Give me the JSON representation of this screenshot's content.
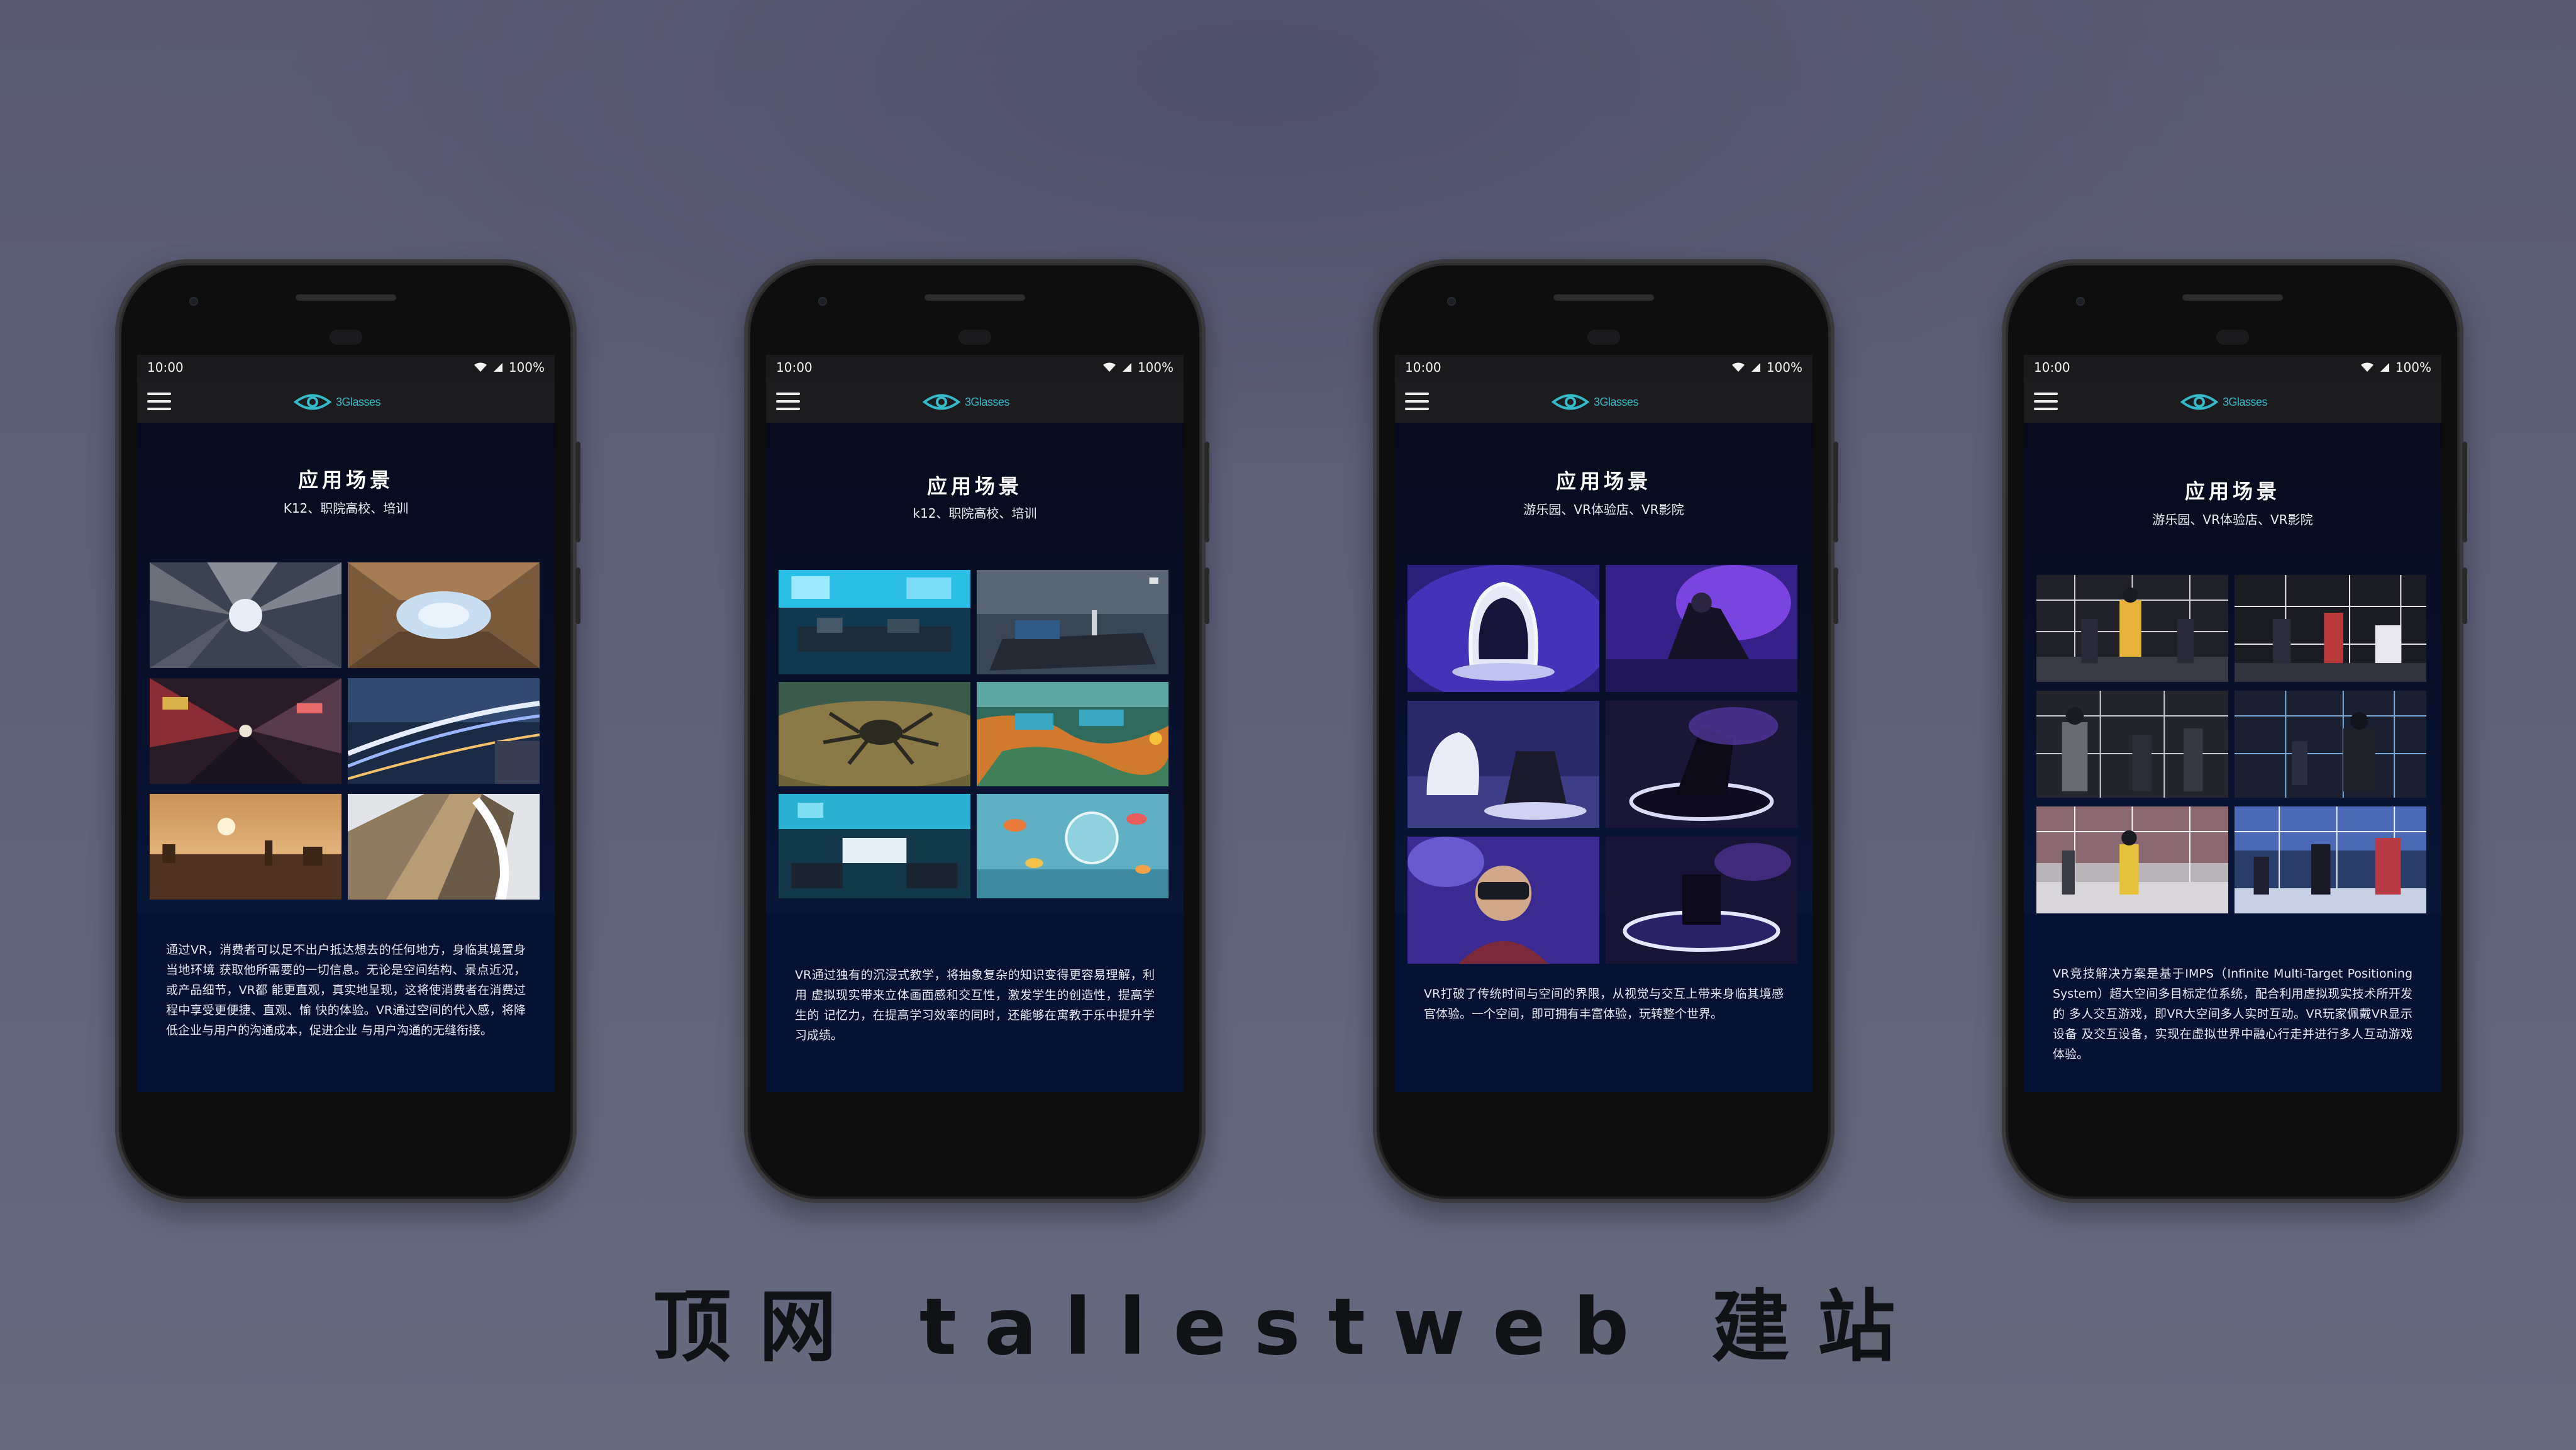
{
  "status_bar": {
    "time": "10:00",
    "battery": "100%"
  },
  "brand": {
    "logo_text": "3Glasses",
    "accent_color": "#35b9c6"
  },
  "phones": [
    {
      "title": "应用场景",
      "subtitle": "K12、职院高校、培训",
      "description": "通过VR，消费者可以足不出户抵达想去的任何地方，身临其境置身当地环境 获取他所需要的一切信息。无论是空间结构、景点近况，或产品细节，VR都 能更直观，真实地呈现，这将使消费者在消费过程中享受更便捷、直观、愉 快的体验。VR通过空间的代入感，将降低企业与用户的沟通成本，促进企业 与用户沟通的无缝衔接。",
      "images": [
        "city-skyscrapers-looking-up",
        "courtyard-sky-looking-up",
        "neon-street-looking-up",
        "light-trails-train-station",
        "sunset-cityscape",
        "curved-glass-building"
      ]
    },
    {
      "title": "应用场景",
      "subtitle": "k12、职院高校、培训",
      "description": "VR通过独有的沉浸式教学，将抽象复杂的知识变得更容易理解，利用 虚拟现实带来立体画面感和交互性，激发学生的创造性，提高学生的 记忆力，在提高学习效率的同时，还能够在寓教于乐中提升学习成绩。",
      "images": [
        "virtual-lab-room",
        "virtual-workbench-room",
        "crab-on-seabed",
        "map-with-floating-panels",
        "virtual-classroom",
        "underwater-fish-scene"
      ]
    },
    {
      "title": "应用场景",
      "subtitle": "游乐园、VR体验店、VR影院",
      "description": "VR打破了传统时间与空间的界限，从视觉与交互上带来身临其境感官体验。一个空间，即可拥有丰富体验，玩转整个世界。",
      "images": [
        "vr-egg-pod-chair",
        "vr-recliner-purple",
        "vr-motion-seats",
        "vr-rotating-seat",
        "vr-headset-user",
        "vr-platform-stage"
      ]
    },
    {
      "title": "应用场景",
      "subtitle": "游乐园、VR体验店、VR影院",
      "description": "VR竞技解决方案是基于IMPS（Infinite Multi-Target Positioning System）超大空间多目标定位系统，配合利用虚拟现实技术所开发的 多人交互游戏，即VR大空间多人实时互动。VR玩家佩戴VR显示设备 及交互设备，实现在虚拟世界中融心行走并进行多人互动游戏体验。",
      "images": [
        "vr-arena-players-1",
        "vr-arena-players-2",
        "vr-arena-players-3",
        "vr-arena-players-4",
        "vr-arena-players-5",
        "vr-arena-players-6"
      ]
    }
  ],
  "caption": "顶网 tallestweb 建站"
}
